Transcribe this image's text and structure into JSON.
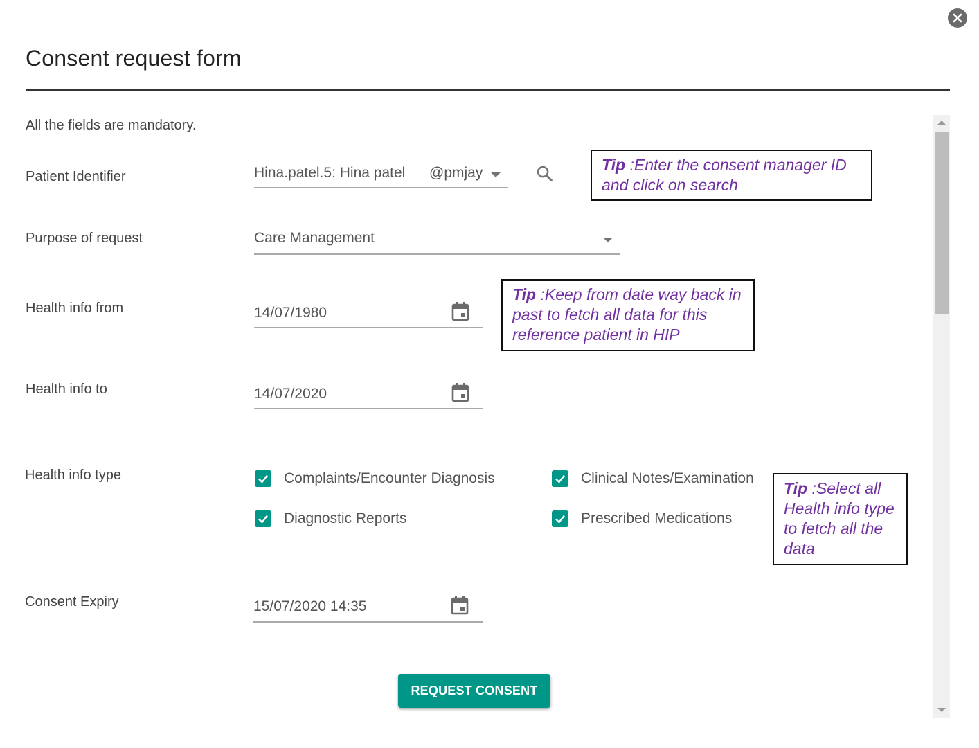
{
  "dialog": {
    "title": "Consent request form",
    "mandatory_note": "All the fields are mandatory.",
    "close_icon": "close-circle-icon"
  },
  "fields": {
    "patient_identifier": {
      "label": "Patient Identifier",
      "value": "Hina.patel.5: Hina patel",
      "suffix": "@pmjay",
      "search_icon": "search-icon"
    },
    "purpose": {
      "label": "Purpose of request",
      "value": "Care Management"
    },
    "health_info_from": {
      "label": "Health info from",
      "value": "14/07/1980",
      "icon": "calendar-icon"
    },
    "health_info_to": {
      "label": "Health info to",
      "value": "14/07/2020",
      "icon": "calendar-icon"
    },
    "health_info_type": {
      "label": "Health info type",
      "options": [
        {
          "label": "Complaints/Encounter Diagnosis",
          "checked": true
        },
        {
          "label": "Clinical Notes/Examination",
          "checked": true
        },
        {
          "label": "Diagnostic Reports",
          "checked": true
        },
        {
          "label": "Prescribed Medications",
          "checked": true
        }
      ]
    },
    "consent_expiry": {
      "label": "Consent Expiry",
      "value": "15/07/2020 14:35",
      "icon": "calendar-icon"
    }
  },
  "tips": [
    {
      "prefix": "Tip",
      "text": " :Enter the consent manager ID and click on search"
    },
    {
      "prefix": "Tip",
      "text": " :Keep from date way back in past to fetch all data for this reference patient in HIP"
    },
    {
      "prefix": "Tip",
      "text": " :Select all Health info type to fetch all the data"
    }
  ],
  "actions": {
    "submit_label": "REQUEST CONSENT"
  },
  "colors": {
    "accent": "#009688",
    "tip_text": "#7030a0",
    "close_bg": "#6b6b6b"
  }
}
